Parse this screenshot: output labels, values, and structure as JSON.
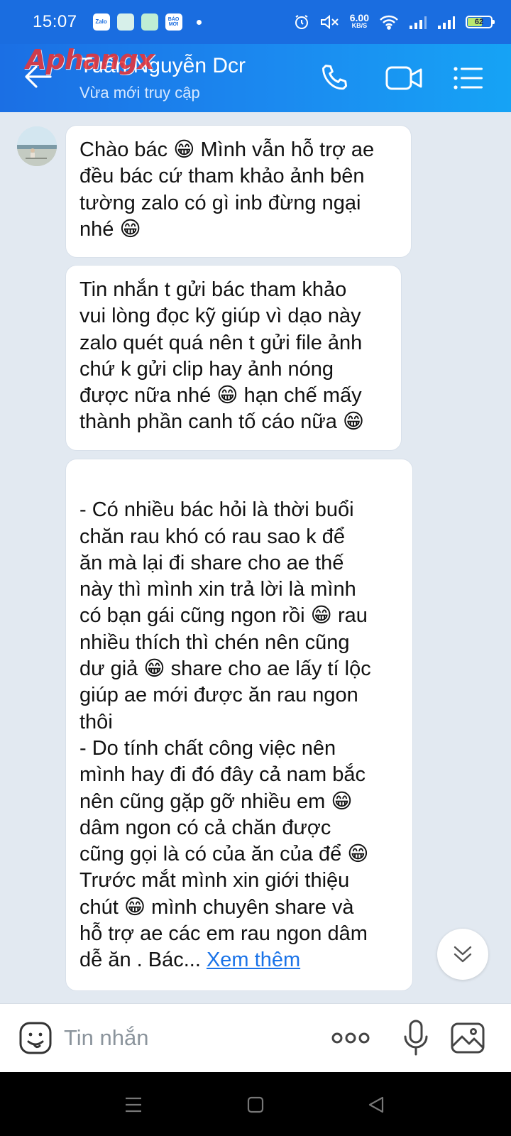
{
  "status_bar": {
    "time": "15:07",
    "notifications": [
      "Zalo",
      "",
      "",
      "BÁO MỚI"
    ],
    "net_speed_value": "6.00",
    "net_speed_unit": "KB/S",
    "battery_percent": "62",
    "battery_level": 0.62,
    "icons": [
      "alarm-icon",
      "mute-icon",
      "wifi-icon",
      "signal-icon",
      "signal-icon",
      "battery-icon"
    ]
  },
  "header": {
    "contact_name": "Tuấn Nguyễn Dcr",
    "contact_status": "Vừa mới truy cập",
    "watermark": "Aphangx",
    "icons": [
      "back-arrow-icon",
      "phone-icon",
      "video-call-icon",
      "menu-icon"
    ]
  },
  "messages": [
    {
      "text": "Chào bác 😁 Mình vẫn hỗ trợ ae\nđều bác cứ tham khảo ảnh bên\ntường zalo có gì inb đừng ngại\nnhé 😁"
    },
    {
      "text": "Tin nhắn t gửi bác tham khảo\nvui lòng đọc kỹ giúp vì dạo này\nzalo quét quá nên t gửi file ảnh\nchứ k gửi clip hay ảnh nóng\nđược nữa nhé 😁 hạn chế mấy\nthành phần canh tố cáo nữa 😁"
    },
    {
      "text": "\n- Có nhiều bác hỏi là thời buổi\nchăn rau khó có rau sao k để\năn mà lại đi share cho ae thế\nnày thì mình xin trả lời là mình\ncó bạn gái cũng ngon rồi 😁 rau\nnhiều thích thì chén nên cũng\ndư giả 😁 share cho ae lấy tí lộc\ngiúp ae mới được ăn rau ngon\nthôi\n- Do tính chất công việc nên\nmình hay đi đó đây cả nam bắc\nnên cũng gặp gỡ nhiều em 😁\ndâm ngon có cả chăn được\ncũng gọi là có của ăn của để 😁\nTrước mắt mình xin giới thiệu\nchút 😁 mình chuyên share và\nhỗ trợ ae các em rau ngon dâm\ndễ ăn . Bác... ",
      "more_label": "Xem thêm"
    }
  ],
  "input_bar": {
    "placeholder": "Tin nhắn",
    "icons": [
      "sticker-icon",
      "more-options-icon",
      "microphone-icon",
      "image-icon"
    ]
  },
  "nav_bar": {
    "icons": [
      "recent-apps-icon",
      "home-icon",
      "back-icon"
    ]
  }
}
